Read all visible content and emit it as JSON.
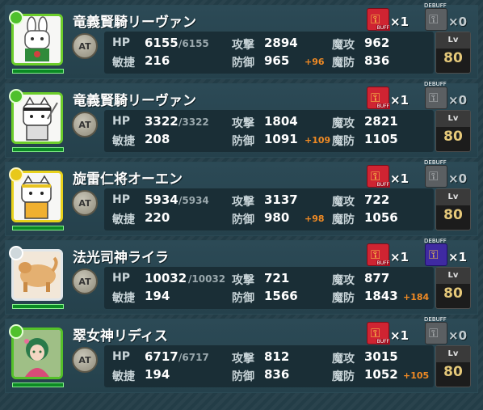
{
  "labels": {
    "hp": "HP",
    "atk": "攻撃",
    "matk": "魔攻",
    "agi": "敏捷",
    "def": "防御",
    "mdef": "魔防",
    "lv": "Lv",
    "at": "AT",
    "buff_tag": "BUFF",
    "debuff_tag": "DEBUFF"
  },
  "units": [
    {
      "name": "竜義賢騎リーヴァン",
      "hp": "6155",
      "hp_max": "/6155",
      "atk": "2894",
      "matk": "962",
      "agi": "216",
      "def": "965",
      "def_bonus": "+96",
      "mdef": "836",
      "mdef_bonus": "",
      "buff_count": "×1",
      "debuff_count": "×0",
      "debuff_active": false,
      "level": "80",
      "frame": "green",
      "portrait_icon": "rabbit-knight-icon"
    },
    {
      "name": "竜義賢騎リーヴァン",
      "hp": "3322",
      "hp_max": "/3322",
      "atk": "1804",
      "matk": "2821",
      "agi": "208",
      "def": "1091",
      "def_bonus": "+109",
      "mdef": "1105",
      "mdef_bonus": "",
      "buff_count": "×1",
      "debuff_count": "×0",
      "debuff_active": false,
      "level": "80",
      "frame": "green",
      "portrait_icon": "cat-warrior-icon"
    },
    {
      "name": "旋雷仁将オーエン",
      "hp": "5934",
      "hp_max": "/5934",
      "atk": "3137",
      "matk": "722",
      "agi": "220",
      "def": "980",
      "def_bonus": "+98",
      "mdef": "1056",
      "mdef_bonus": "",
      "buff_count": "×1",
      "debuff_count": "×0",
      "debuff_active": false,
      "level": "80",
      "frame": "yellow",
      "portrait_icon": "cat-general-icon"
    },
    {
      "name": "法光司神ライラ",
      "hp": "10032",
      "hp_max": "/10032",
      "atk": "721",
      "matk": "877",
      "agi": "194",
      "def": "1566",
      "def_bonus": "",
      "mdef": "1843",
      "mdef_bonus": "+184",
      "buff_count": "×1",
      "debuff_count": "×1",
      "debuff_active": true,
      "level": "80",
      "frame": "white",
      "portrait_icon": "golden-beast-icon"
    },
    {
      "name": "翠女神リディス",
      "hp": "6717",
      "hp_max": "/6717",
      "atk": "812",
      "matk": "3015",
      "agi": "194",
      "def": "836",
      "def_bonus": "",
      "mdef": "1052",
      "mdef_bonus": "+105",
      "buff_count": "×1",
      "debuff_count": "×0",
      "debuff_active": false,
      "level": "80",
      "frame": "green2",
      "portrait_icon": "goddess-icon"
    }
  ],
  "colors": {
    "background": "#233d47",
    "frame_green": "#6ccd2b",
    "frame_yellow": "#e8d21c",
    "frame_white": "#e0e6ea",
    "bonus": "#f08a24",
    "buff": "#cf2432",
    "debuff_active": "#3f2aa2"
  }
}
